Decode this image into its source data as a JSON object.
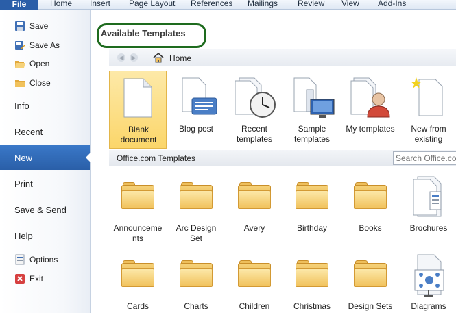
{
  "ribbon": {
    "file_label": "File",
    "tabs": [
      "Home",
      "Insert",
      "Page Layout",
      "References",
      "Mailings",
      "Review",
      "View",
      "Add-Ins"
    ]
  },
  "nav": {
    "save": "Save",
    "save_as": "Save As",
    "open": "Open",
    "close": "Close",
    "info": "Info",
    "recent": "Recent",
    "new": "New",
    "print": "Print",
    "save_send": "Save & Send",
    "help": "Help",
    "options": "Options",
    "exit": "Exit"
  },
  "main": {
    "heading": "Available Templates",
    "breadcrumb": "Home",
    "home_templates": [
      {
        "line1": "Blank",
        "line2": "document",
        "icon": "blank-document-icon"
      },
      {
        "line1": "Blog post",
        "line2": "",
        "icon": "blog-post-icon"
      },
      {
        "line1": "Recent",
        "line2": "templates",
        "icon": "recent-templates-icon"
      },
      {
        "line1": "Sample",
        "line2": "templates",
        "icon": "sample-templates-icon"
      },
      {
        "line1": "My templates",
        "line2": "",
        "icon": "my-templates-icon"
      },
      {
        "line1": "New from",
        "line2": "existing",
        "icon": "new-from-existing-icon"
      }
    ],
    "office_section_title": "Office.com Templates",
    "search_placeholder": "Search Office.com for templates",
    "office_row1": [
      {
        "line1": "Announceme",
        "line2": "nts"
      },
      {
        "line1": "Arc Design",
        "line2": "Set"
      },
      {
        "line1": "Avery",
        "line2": ""
      },
      {
        "line1": "Birthday",
        "line2": ""
      },
      {
        "line1": "Books",
        "line2": ""
      },
      {
        "line1": "Brochures",
        "line2": ""
      }
    ],
    "office_row2": [
      {
        "line1": "Cards",
        "line2": ""
      },
      {
        "line1": "Charts",
        "line2": ""
      },
      {
        "line1": "Children",
        "line2": ""
      },
      {
        "line1": "Christmas",
        "line2": ""
      },
      {
        "line1": "Design Sets",
        "line2": ""
      },
      {
        "line1": "Diagrams",
        "line2": ""
      }
    ]
  },
  "colors": {
    "file_tab": "#2a5ea8",
    "nav_selected": "#2f6bbd",
    "annotation_circle": "#1e6b1e",
    "selected_tile": "#fbd66a"
  }
}
